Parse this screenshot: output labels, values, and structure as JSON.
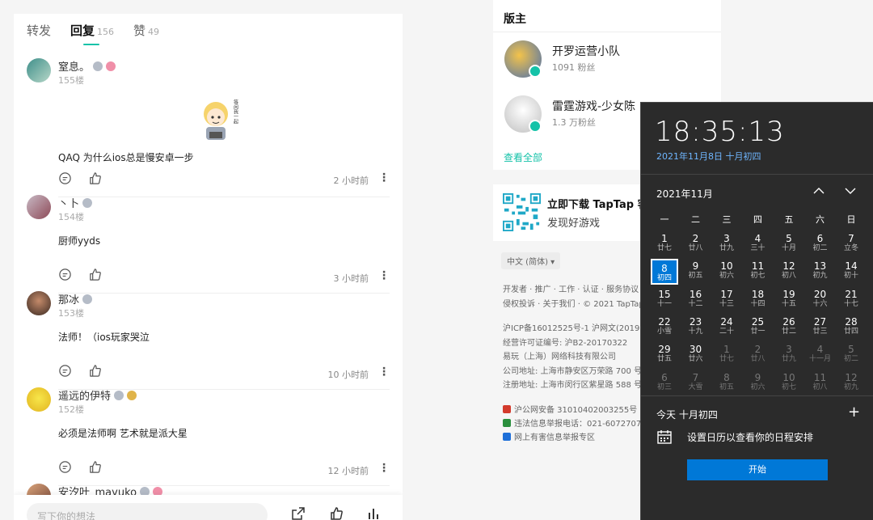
{
  "comments_panel": {
    "tabs": [
      {
        "label": "转发",
        "count": ""
      },
      {
        "label": "回复",
        "count": "156"
      },
      {
        "label": "赞",
        "count": "49"
      }
    ],
    "comments": [
      {
        "name": "窒息。",
        "floor": "155楼",
        "text": "QAQ   为什么ios总是慢安卓一步",
        "time": "2 小时前",
        "sticker_text": "等闲我一起"
      },
      {
        "name": "丶卜",
        "floor": "154楼",
        "text": "厨师yyds",
        "time": "3 小时前"
      },
      {
        "name": "那冰",
        "floor": "153楼",
        "text": "法师！（ios玩家哭泣",
        "time": "10 小时前"
      },
      {
        "name": "遥远的伊特",
        "floor": "152楼",
        "text": "必须是法师啊  艺术就是派大星",
        "time": "12 小时前"
      },
      {
        "name": "安汐叶_mayuko",
        "floor": "",
        "text": "",
        "time": ""
      }
    ],
    "reply_placeholder": "写下你的想法",
    "more_glyph": "⋮"
  },
  "moderators": {
    "title": "版主",
    "items": [
      {
        "name": "开罗运营小队",
        "fans": "1091 粉丝"
      },
      {
        "name": "雷霆游戏-少女陈",
        "fans": "1.3 万粉丝"
      }
    ],
    "see_all": "查看全部"
  },
  "download": {
    "title": "立即下载 TapTap 客",
    "subtitle": "发现好游戏"
  },
  "footer": {
    "language": "中文 (简体) ▾",
    "lines": [
      "开发者 · 推广 · 工作 · 认证 · 服务协议 · 隐",
      "侵权投诉 · 关于我们 · © 2021 TapTap",
      "沪ICP备16012525号-1    沪网文(2019)35",
      "经营许可证编号: 沪B2-20170322",
      "易玩（上海）网络科技有限公司",
      "公司地址: 上海市静安区万荣路 700 号 A",
      "注册地址: 上海市闵行区紫星路 588 号 2"
    ],
    "badges": [
      {
        "text": "沪公网安备 31010402003255号",
        "color": "#d33a2c"
      },
      {
        "text": "违法信息举报电话：021-60727072转",
        "color": "#2a8f3d"
      },
      {
        "text": "网上有害信息举报专区",
        "color": "#1e6fd8"
      }
    ]
  },
  "clock": {
    "time": "18:35:13",
    "date": "2021年11月8日 十月初四",
    "month": "2021年11月",
    "weekdays": [
      "一",
      "二",
      "三",
      "四",
      "五",
      "六",
      "日"
    ],
    "days": [
      [
        "1",
        "廿七"
      ],
      [
        "2",
        "廿八"
      ],
      [
        "3",
        "廿九"
      ],
      [
        "4",
        "三十"
      ],
      [
        "5",
        "十月"
      ],
      [
        "6",
        "初二"
      ],
      [
        "7",
        "立冬"
      ],
      [
        "8",
        "初四"
      ],
      [
        "9",
        "初五"
      ],
      [
        "10",
        "初六"
      ],
      [
        "11",
        "初七"
      ],
      [
        "12",
        "初八"
      ],
      [
        "13",
        "初九"
      ],
      [
        "14",
        "初十"
      ],
      [
        "15",
        "十一"
      ],
      [
        "16",
        "十二"
      ],
      [
        "17",
        "十三"
      ],
      [
        "18",
        "十四"
      ],
      [
        "19",
        "十五"
      ],
      [
        "20",
        "十六"
      ],
      [
        "21",
        "十七"
      ],
      [
        "22",
        "小雪"
      ],
      [
        "23",
        "十九"
      ],
      [
        "24",
        "二十"
      ],
      [
        "25",
        "廿一"
      ],
      [
        "26",
        "廿二"
      ],
      [
        "27",
        "廿三"
      ],
      [
        "28",
        "廿四"
      ],
      [
        "29",
        "廿五"
      ],
      [
        "30",
        "廿六"
      ],
      [
        "1",
        "廿七"
      ],
      [
        "2",
        "廿八"
      ],
      [
        "3",
        "廿九"
      ],
      [
        "4",
        "十一月"
      ],
      [
        "5",
        "初二"
      ],
      [
        "6",
        "初三"
      ],
      [
        "7",
        "大雪"
      ],
      [
        "8",
        "初五"
      ],
      [
        "9",
        "初六"
      ],
      [
        "10",
        "初七"
      ],
      [
        "11",
        "初八"
      ],
      [
        "12",
        "初九"
      ]
    ],
    "today_index": 7,
    "dim_from_index": 30,
    "today_label": "今天  十月初四",
    "agenda_text": "设置日历以查看你的日程安排",
    "start_button": "开始",
    "colors": {
      "accent": "#0078d7",
      "link": "#6fb6ff",
      "bg": "#2b2b2b"
    }
  },
  "colors": {
    "brand": "#14c2a8"
  }
}
